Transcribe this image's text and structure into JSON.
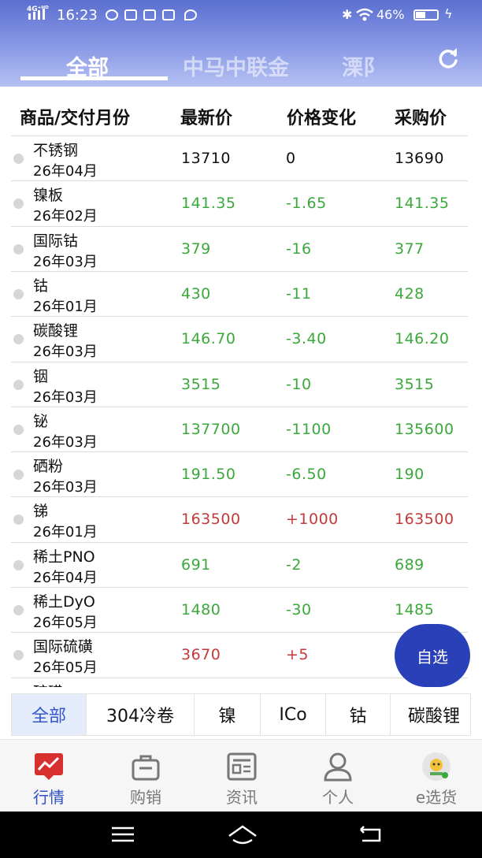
{
  "status_bar": {
    "network": "4G⁺ᴴᴰ",
    "time": "16:23",
    "battery": "46%",
    "battery_level": 0.46
  },
  "top_tabs": [
    {
      "label": "全部",
      "active": true
    },
    {
      "label": "中马中联金",
      "active": false
    },
    {
      "label": "溧阝",
      "active": false
    }
  ],
  "table": {
    "headers": [
      "商品/交付月份",
      "最新价",
      "价格变化",
      "采购价"
    ],
    "rows": [
      {
        "name": "不锈钢",
        "month": "26年04月",
        "latest": "13710",
        "change": "0",
        "buy": "13690",
        "trend": "flat"
      },
      {
        "name": "镍板",
        "month": "26年02月",
        "latest": "141.35",
        "change": "-1.65",
        "buy": "141.35",
        "trend": "down"
      },
      {
        "name": "国际钴",
        "month": "26年03月",
        "latest": "379",
        "change": "-16",
        "buy": "377",
        "trend": "down"
      },
      {
        "name": "钴",
        "month": "26年01月",
        "latest": "430",
        "change": "-11",
        "buy": "428",
        "trend": "down"
      },
      {
        "name": "碳酸锂",
        "month": "26年03月",
        "latest": "146.70",
        "change": "-3.40",
        "buy": "146.20",
        "trend": "down"
      },
      {
        "name": "铟",
        "month": "26年03月",
        "latest": "3515",
        "change": "-10",
        "buy": "3515",
        "trend": "down"
      },
      {
        "name": "铋",
        "month": "26年03月",
        "latest": "137700",
        "change": "-1100",
        "buy": "135600",
        "trend": "down"
      },
      {
        "name": "硒粉",
        "month": "26年03月",
        "latest": "191.50",
        "change": "-6.50",
        "buy": "190",
        "trend": "down"
      },
      {
        "name": "锑",
        "month": "26年01月",
        "latest": "163500",
        "change": "+1000",
        "buy": "163500",
        "trend": "up"
      },
      {
        "name": "稀土PNO",
        "month": "26年04月",
        "latest": "691",
        "change": "-2",
        "buy": "689",
        "trend": "down"
      },
      {
        "name": "稀土DyO",
        "month": "26年05月",
        "latest": "1480",
        "change": "-30",
        "buy": "1485",
        "trend": "down"
      },
      {
        "name": "国际硫磺",
        "month": "26年05月",
        "latest": "3670",
        "change": "+5",
        "buy": "",
        "trend": "up"
      },
      {
        "name": "硫磺",
        "month": "",
        "latest": "",
        "change": "",
        "buy": "",
        "trend": "flat"
      }
    ]
  },
  "fab": {
    "label": "自选"
  },
  "category_tabs": [
    {
      "label": "全部",
      "active": true
    },
    {
      "label": "304冷卷",
      "active": false
    },
    {
      "label": "镍",
      "active": false
    },
    {
      "label": "ICo",
      "active": false
    },
    {
      "label": "钴",
      "active": false
    },
    {
      "label": "碳酸锂",
      "active": false
    }
  ],
  "bottom_nav": [
    {
      "label": "行情",
      "icon": "market-chart-icon",
      "active": true
    },
    {
      "label": "购销",
      "icon": "shopping-bag-icon",
      "active": false
    },
    {
      "label": "资讯",
      "icon": "news-icon",
      "active": false
    },
    {
      "label": "个人",
      "icon": "person-icon",
      "active": false
    },
    {
      "label": "e选货",
      "icon": "e-select-logo-icon",
      "active": false
    }
  ],
  "colors": {
    "up": "#c33a3a",
    "down": "#3aa83a",
    "flat": "#111111",
    "brand": "#2a40b8",
    "active_nav": "#2d4fc4"
  }
}
